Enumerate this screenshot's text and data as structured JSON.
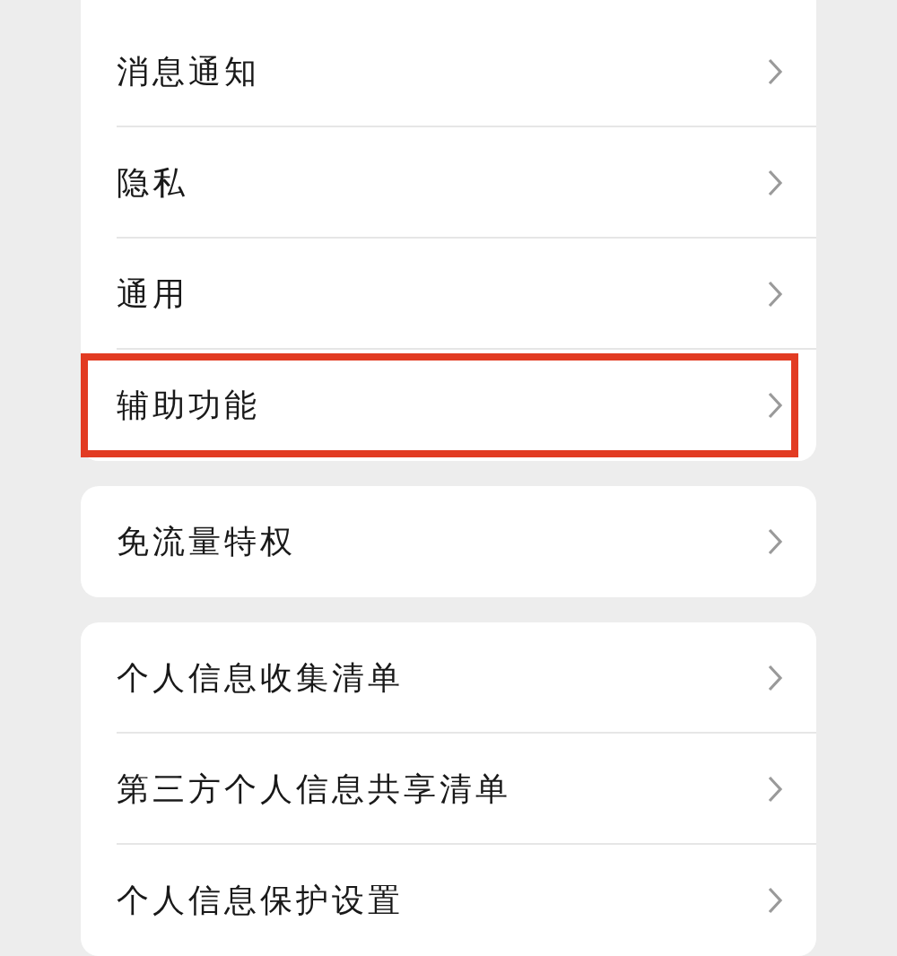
{
  "groups": [
    {
      "items": [
        {
          "label": "消息通知",
          "highlighted": false
        },
        {
          "label": "隐私",
          "highlighted": false
        },
        {
          "label": "通用",
          "highlighted": false
        },
        {
          "label": "辅助功能",
          "highlighted": true
        }
      ]
    },
    {
      "items": [
        {
          "label": "免流量特权",
          "highlighted": false
        }
      ]
    },
    {
      "items": [
        {
          "label": "个人信息收集清单",
          "highlighted": false
        },
        {
          "label": "第三方个人信息共享清单",
          "highlighted": false
        },
        {
          "label": "个人信息保护设置",
          "highlighted": false
        }
      ]
    }
  ]
}
